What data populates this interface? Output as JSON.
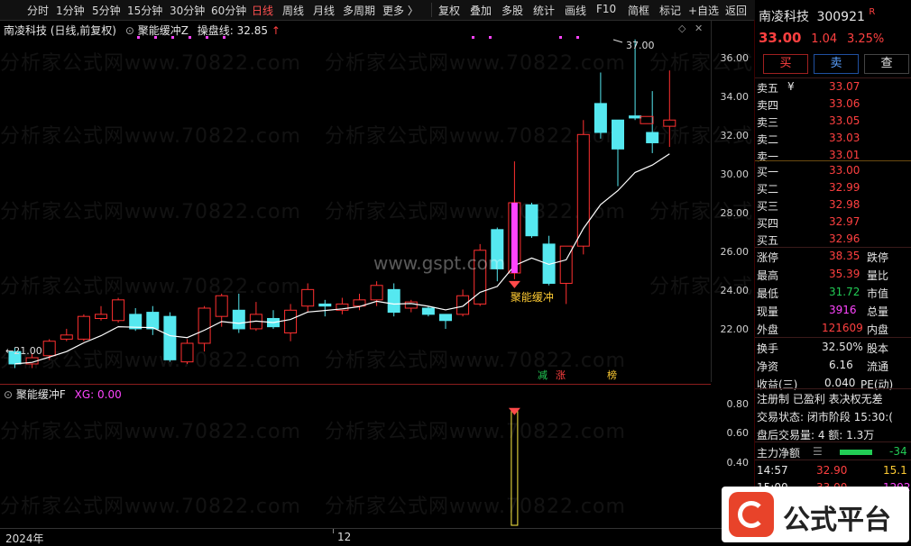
{
  "toolbar": {
    "periods": [
      "分时",
      "1分钟",
      "5分钟",
      "15分钟",
      "30分钟",
      "60分钟",
      "日线",
      "周线",
      "月线",
      "多周期",
      "更多 〉"
    ],
    "tools": [
      "复权",
      "叠加",
      "多股",
      "统计",
      "画线",
      "F10",
      "简框",
      "标记",
      "+自选",
      "返回"
    ]
  },
  "chart": {
    "title_stock": "南凌科技 (日线,前复权)",
    "indicator_name": "聚能缓冲Z",
    "line_label": "操盘线:",
    "line_value": "32.85",
    "line_arrow": "↑",
    "high_label": "37.00",
    "low_label": "←21.00",
    "signal_label": "聚能缓冲",
    "event_tags": [
      "减",
      "涨",
      "榜"
    ],
    "watermark_text": "分析家公式网www.70822.com",
    "site_watermark": "www.gspt.com",
    "y_ticks": [
      "36.00",
      "34.00",
      "32.00",
      "30.00",
      "28.00",
      "26.00",
      "24.00",
      "22.00"
    ],
    "colors": {
      "up": "#ff3030",
      "down": "#55e8f0",
      "line": "#ffffff",
      "signal": "#ff44ff",
      "tag": "#ffcc33"
    }
  },
  "chart_data": {
    "type": "candlestick",
    "y_range": [
      20.5,
      37.5
    ],
    "candles": [
      [
        21.8,
        21.2,
        22.0,
        21.0
      ],
      [
        21.2,
        21.5,
        21.7,
        21.0
      ],
      [
        21.6,
        22.3,
        22.4,
        21.4
      ],
      [
        22.4,
        22.6,
        22.9,
        22.3
      ],
      [
        22.4,
        23.5,
        23.6,
        22.3
      ],
      [
        23.4,
        23.6,
        24.0,
        23.3
      ],
      [
        23.3,
        24.3,
        24.4,
        23.2
      ],
      [
        23.6,
        22.9,
        23.9,
        22.8
      ],
      [
        23.7,
        22.9,
        24.0,
        22.6
      ],
      [
        23.5,
        21.4,
        23.7,
        21.3
      ],
      [
        21.3,
        22.2,
        22.4,
        21.2
      ],
      [
        22.2,
        23.9,
        24.0,
        21.8
      ],
      [
        23.5,
        24.5,
        24.6,
        23.0
      ],
      [
        23.8,
        22.9,
        24.6,
        22.7
      ],
      [
        22.9,
        23.6,
        24.2,
        22.8
      ],
      [
        23.4,
        23.0,
        23.8,
        22.9
      ],
      [
        22.7,
        23.8,
        24.1,
        22.3
      ],
      [
        24.0,
        24.8,
        25.1,
        23.7
      ],
      [
        24.1,
        24.0,
        24.3,
        23.5
      ],
      [
        23.8,
        24.1,
        24.4,
        23.6
      ],
      [
        24.0,
        24.3,
        24.6,
        23.8
      ],
      [
        24.3,
        25.0,
        25.2,
        24.0
      ],
      [
        24.8,
        23.7,
        25.1,
        23.5
      ],
      [
        23.9,
        24.2,
        24.3,
        23.7
      ],
      [
        23.9,
        23.6,
        24.0,
        23.5
      ],
      [
        23.6,
        23.3,
        23.6,
        22.9
      ],
      [
        23.6,
        24.5,
        24.8,
        23.5
      ],
      [
        24.1,
        26.7,
        27.0,
        24.0
      ],
      [
        27.7,
        25.8,
        27.8,
        25.2
      ],
      [
        25.6,
        29.0,
        31.0,
        25.3
      ],
      [
        28.9,
        27.4,
        29.0,
        27.3
      ],
      [
        27.0,
        25.1,
        27.4,
        25.0
      ],
      [
        25.1,
        26.9,
        26.9,
        24.1
      ],
      [
        26.9,
        32.3,
        33.0,
        26.5
      ],
      [
        33.8,
        32.4,
        35.3,
        32.1
      ],
      [
        33.0,
        31.6,
        33.0,
        29.8
      ],
      [
        33.2,
        33.1,
        36.9,
        33.0
      ],
      [
        32.4,
        31.9,
        34.4,
        31.4
      ],
      [
        32.7,
        33.0,
        35.4,
        31.7
      ]
    ],
    "signal_bar_index": 29,
    "indicator": {
      "name": "聚能缓冲F",
      "label": "XG:",
      "value": "0.00",
      "y_ticks": [
        "0.80",
        "0.60",
        "0.40"
      ],
      "y_range": [
        0,
        0.9
      ],
      "signal_value": 0.8
    },
    "x_labels": [
      "2024年",
      "12"
    ]
  },
  "panel": {
    "stock_name": "南凌科技",
    "stock_code": "300921",
    "badge": "R",
    "price": "33.00",
    "change": "1.04",
    "change_pct": "3.25%",
    "buttons": [
      "买",
      "卖",
      "查"
    ],
    "asks": [
      {
        "label": "卖五",
        "price": "33.07"
      },
      {
        "label": "卖四",
        "price": "33.06"
      },
      {
        "label": "卖三",
        "price": "33.05"
      },
      {
        "label": "卖二",
        "price": "33.03"
      },
      {
        "label": "卖一",
        "price": "33.01"
      }
    ],
    "bids": [
      {
        "label": "买一",
        "price": "33.00"
      },
      {
        "label": "买二",
        "price": "32.99"
      },
      {
        "label": "买三",
        "price": "32.98"
      },
      {
        "label": "买四",
        "price": "32.97"
      },
      {
        "label": "买五",
        "price": "32.96"
      }
    ],
    "ask_currency": "¥",
    "stats": [
      {
        "l": "涨停",
        "v": "38.35",
        "r": "跌停",
        "c": "red"
      },
      {
        "l": "最高",
        "v": "35.39",
        "r": "量比",
        "c": "red"
      },
      {
        "l": "最低",
        "v": "31.72",
        "r": "市值",
        "c": "green"
      },
      {
        "l": "现量",
        "v": "3916",
        "r": "总量",
        "c": "magenta"
      },
      {
        "l": "外盘",
        "v": "121609",
        "r": "内盘",
        "c": "red"
      }
    ],
    "stats2": [
      {
        "l": "换手",
        "v": "32.50%",
        "r": "股本"
      },
      {
        "l": "净资",
        "v": "6.16",
        "r": "流通"
      },
      {
        "l": "收益(三)",
        "v": "0.040",
        "r": "PE(动)"
      }
    ],
    "notice": "注册制 已盈利 表决权无差",
    "trade_state": "交易状态: 闭市阶段 15:30:(",
    "after_hours": "盘后交易量: 4  额: 1.3万",
    "main_flow_label": "主力净额",
    "main_flow_value": "-34",
    "ticks": [
      {
        "t": "14:57",
        "p": "32.90",
        "v": "15.1"
      },
      {
        "t": "15:00",
        "p": "33.00",
        "v": "1292.3"
      }
    ],
    "logo_text": "公式平台"
  }
}
